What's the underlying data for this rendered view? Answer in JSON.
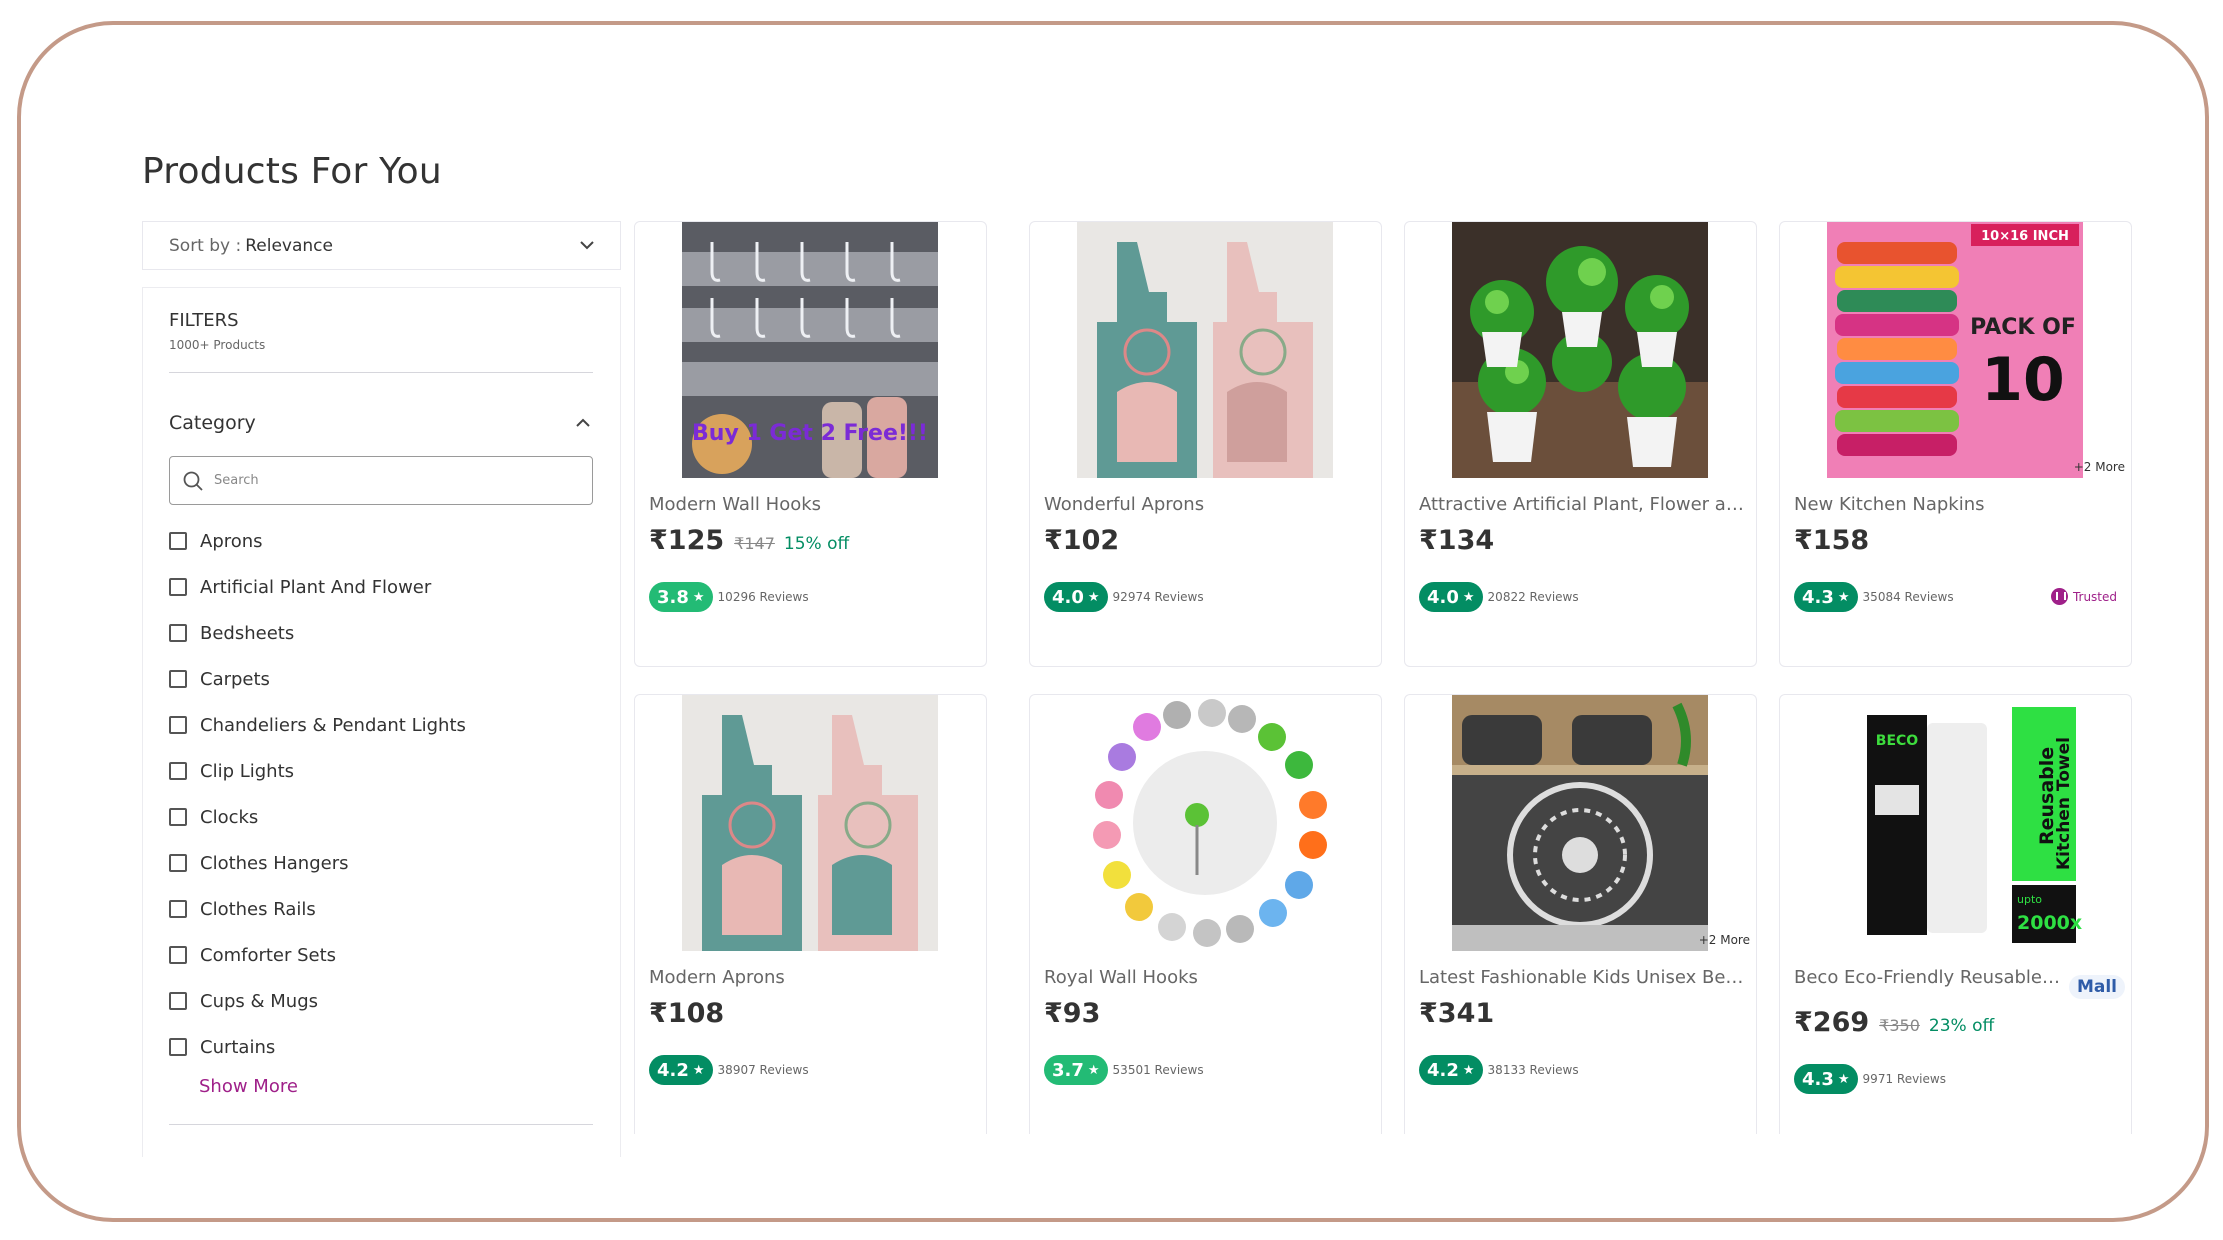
{
  "page": {
    "title": "Products For You"
  },
  "sort": {
    "prefix": "Sort by :",
    "value": "Relevance"
  },
  "filters": {
    "title": "FILTERS",
    "count": "1000+ Products",
    "category_title": "Category",
    "search_placeholder": "Search",
    "categories": [
      "Aprons",
      "Artificial Plant And Flower",
      "Bedsheets",
      "Carpets",
      "Chandeliers & Pendant Lights",
      "Clip Lights",
      "Clocks",
      "Clothes Hangers",
      "Clothes Rails",
      "Comforter Sets",
      "Cups & Mugs",
      "Curtains"
    ],
    "show_more": "Show More"
  },
  "products": [
    {
      "name": "Modern Wall Hooks",
      "price": "₹125",
      "mrp": "₹147",
      "discount": "15% off",
      "rating": "3.8",
      "rating_color": "#23bb75",
      "reviews": "10296 Reviews",
      "image_icon": "wall-hooks-icon",
      "image_text": "Buy 1 Get 2 Free!!!"
    },
    {
      "name": "Wonderful Aprons",
      "price": "₹102",
      "rating": "4.0",
      "rating_color": "#038d63",
      "reviews": "92974 Reviews",
      "image_icon": "apron-icon"
    },
    {
      "name": "Attractive Artificial Plant, Flower and ...",
      "price": "₹134",
      "rating": "4.0",
      "rating_color": "#038d63",
      "reviews": "20822 Reviews",
      "image_icon": "potted-plant-icon"
    },
    {
      "name": "New Kitchen Napkins",
      "price": "₹158",
      "rating": "4.3",
      "rating_color": "#038d63",
      "reviews": "35084 Reviews",
      "more": "+2 More",
      "trusted": "Trusted",
      "image_icon": "napkins-icon",
      "image_text": {
        "size": "10×16 INCH",
        "pack": "PACK OF",
        "count": "10"
      }
    },
    {
      "name": "Modern Aprons",
      "price": "₹108",
      "rating": "4.2",
      "rating_color": "#038d63",
      "reviews": "38907 Reviews",
      "image_icon": "apron-icon"
    },
    {
      "name": "Royal Wall Hooks",
      "price": "₹93",
      "rating": "3.7",
      "rating_color": "#23bb75",
      "reviews": "53501 Reviews",
      "image_icon": "thumb-hooks-icon"
    },
    {
      "name": "Latest Fashionable Kids Unisex Bedsh...",
      "price": "₹341",
      "rating": "4.2",
      "rating_color": "#038d63",
      "reviews": "38133 Reviews",
      "more": "+2 More",
      "image_icon": "bedsheet-icon"
    },
    {
      "name": "Beco Eco-Friendly Reusable Kit...",
      "price": "₹269",
      "mrp": "₹350",
      "discount": "23% off",
      "rating": "4.3",
      "rating_color": "#038d63",
      "reviews": "9971 Reviews",
      "mall": "Mall",
      "image_icon": "kitchen-towel-icon",
      "image_text": {
        "brand": "BECO",
        "line1": "Reusable",
        "line2": "Kitchen Towel",
        "upto": "upto",
        "times": "2000x"
      }
    }
  ],
  "colors": {
    "brand": "#9f2089",
    "green_dark": "#038d63",
    "green_light": "#23bb75",
    "frame": "#c49a88"
  }
}
